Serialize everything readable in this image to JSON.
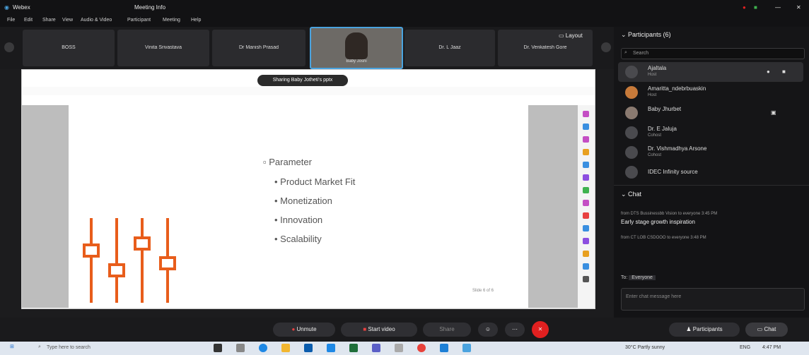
{
  "window": {
    "app_title": "Webex",
    "meeting_title": "Meeting Info",
    "menu_items": [
      "File",
      "Edit",
      "Share",
      "View",
      "Audio & Video",
      "Participant",
      "Meeting",
      "Help"
    ]
  },
  "strip": {
    "tiles": [
      "BOSS",
      "Vinita Srivastava",
      "Dr Manish Prasad",
      "Baby Joshi",
      "Dr. L Jaaz",
      "Dr. Venkatesh Gore"
    ],
    "layout_label": "Layout"
  },
  "share": {
    "sharing_banner": "Sharing Baby Jotheti's pptx",
    "slide": {
      "title": "Parameter",
      "bullets": [
        "Product Market Fit",
        "Monetization",
        "Innovation",
        "Scalability"
      ],
      "slide_number": "Slide 6 of 6"
    }
  },
  "participants": {
    "header": "Participants (6)",
    "search_placeholder": "Search",
    "rows": [
      {
        "name": "Ajaltala",
        "role": "Host"
      },
      {
        "name": "Amaritta_ndebrbuaskin",
        "role": "Host"
      },
      {
        "name": "Baby Jhurbet",
        "role": ""
      },
      {
        "name": "Dr. E Jaluja",
        "role": "Cohost"
      },
      {
        "name": "Dr. Vishmadhya Arsone",
        "role": "Cohost"
      },
      {
        "name": "IDEC Infinity source",
        "role": ""
      }
    ]
  },
  "chat": {
    "header": "Chat",
    "messages": [
      {
        "meta": "from DTS Bussinessbb Vision to everyone   3:45 PM",
        "text": "Early stage growth inspiration"
      },
      {
        "meta": "from CT LOB CSDOOO to everyone   3:48 PM",
        "text": ""
      }
    ],
    "to_label": "To:",
    "to_value": "Everyone",
    "input_placeholder": "Enter chat message here"
  },
  "controls": {
    "unmute": "Unmute",
    "start_video": "Start video",
    "share": "Share",
    "participants": "Participants",
    "chat": "Chat"
  },
  "taskbar": {
    "search_placeholder": "Type here to search",
    "weather": "30°C Partly sunny",
    "time": "4:47 PM",
    "lang": "ENG"
  },
  "colors": {
    "accent": "#4aa3df",
    "end_call": "#e02020",
    "slider_orange": "#e85d1b"
  }
}
